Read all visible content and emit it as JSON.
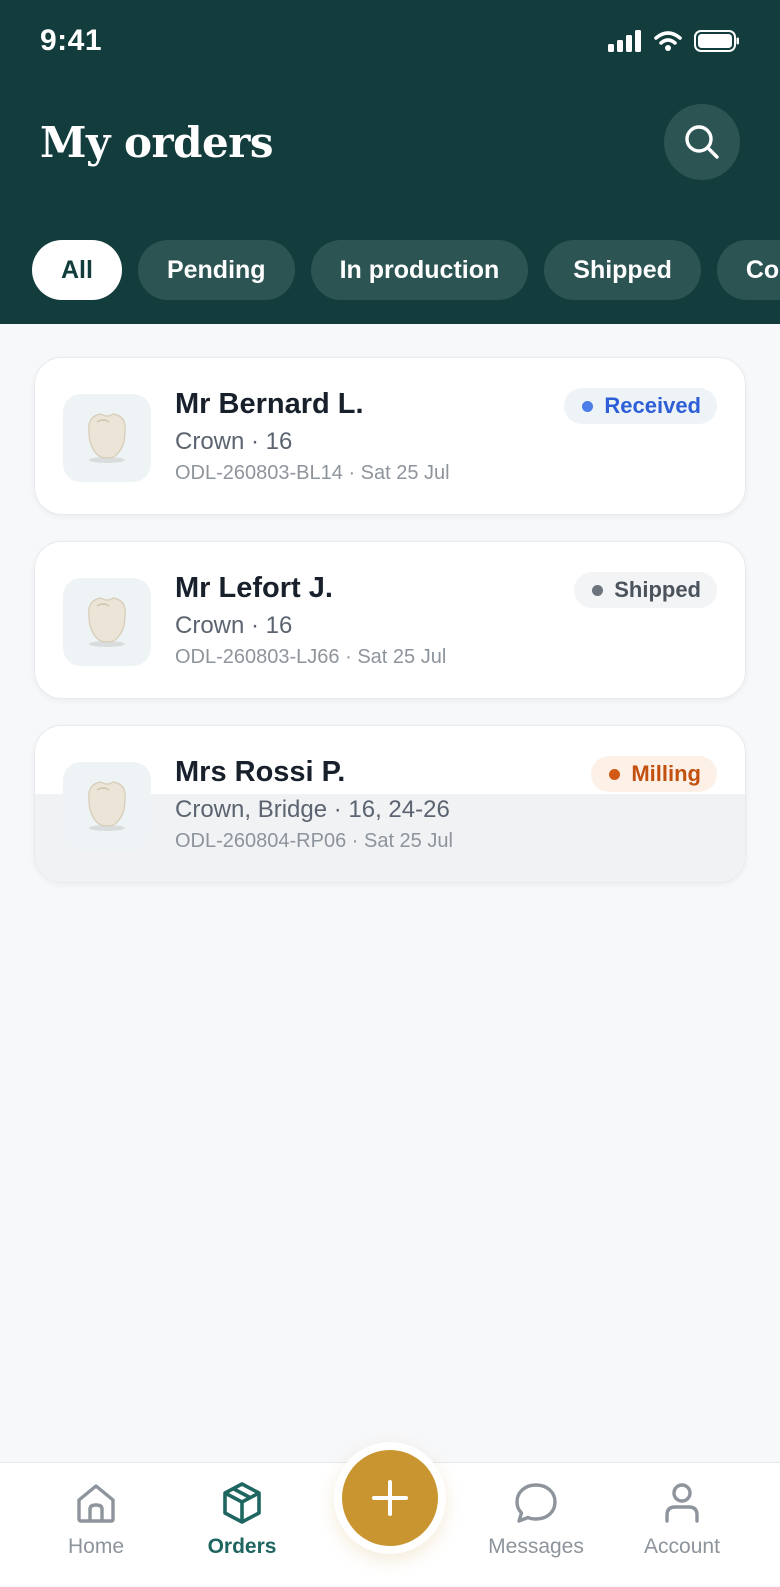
{
  "status_bar": {
    "time": "9:41"
  },
  "header": {
    "title": "My orders"
  },
  "filters": [
    {
      "label": "All",
      "active": true
    },
    {
      "label": "Pending",
      "active": false
    },
    {
      "label": "In production",
      "active": false
    },
    {
      "label": "Shipped",
      "active": false
    },
    {
      "label": "Co",
      "active": false
    }
  ],
  "orders": [
    {
      "patient": "Mr Bernard L.",
      "type": "Crown · 16",
      "meta": "ODL-260803-BL14 · Sat 25 Jul",
      "status": "Received",
      "status_color": "#2f5fd6",
      "status_bg": "#eef3f8",
      "status_dot": "#4a7de8"
    },
    {
      "patient": "Mr Lefort J.",
      "type": "Crown · 16",
      "meta": "ODL-260803-LJ66 · Sat 25 Jul",
      "status": "Shipped",
      "status_color": "#4b535c",
      "status_bg": "#f2f4f6",
      "status_dot": "#6b737c"
    },
    {
      "patient": "Mrs Rossi P.",
      "type": "Crown, Bridge · 16, 24-26",
      "meta": "ODL-260804-RP06 · Sat 25 Jul",
      "status": "Milling",
      "status_color": "#c2500f",
      "status_bg": "#fdf1e7",
      "status_dot": "#d35a14"
    }
  ],
  "tabbar": {
    "home": "Home",
    "orders": "Orders",
    "messages": "Messages",
    "account": "Account"
  },
  "colors": {
    "header_bg": "#133d3d",
    "accent": "#1f6560",
    "fab": "#c99530"
  }
}
